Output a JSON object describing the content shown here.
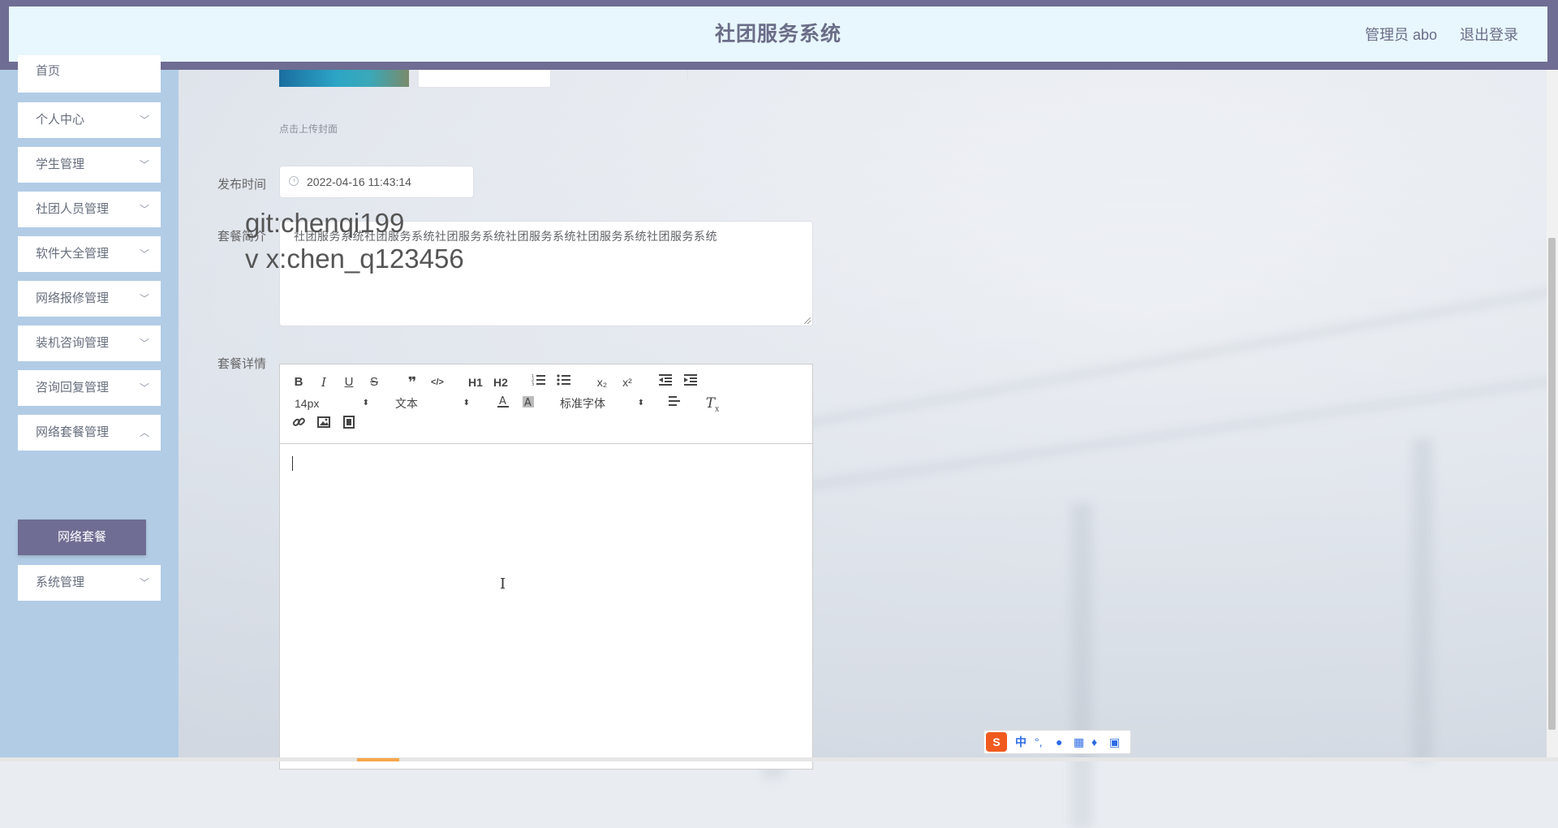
{
  "header": {
    "title": "社团服务系统",
    "user": "管理员 abo",
    "logout": "退出登录"
  },
  "sidebar": {
    "items": [
      {
        "label": "首页",
        "has_chevron": false
      },
      {
        "label": "个人中心",
        "has_chevron": true
      },
      {
        "label": "学生管理",
        "has_chevron": true
      },
      {
        "label": "社团人员管理",
        "has_chevron": true
      },
      {
        "label": "软件大全管理",
        "has_chevron": true
      },
      {
        "label": "网络报修管理",
        "has_chevron": true
      },
      {
        "label": "装机咨询管理",
        "has_chevron": true
      },
      {
        "label": "咨询回复管理",
        "has_chevron": true
      },
      {
        "label": "网络套餐管理",
        "has_chevron": true,
        "expanded": true
      },
      {
        "label": "系统管理",
        "has_chevron": true
      }
    ],
    "active_sub_item": "网络套餐",
    "active_color": "#6f6d93"
  },
  "form": {
    "cover_hint": "点击上传封面",
    "publish_time_label": "发布时间",
    "publish_time_value": "2022-04-16 11:43:14",
    "intro_label": "套餐简介",
    "intro_value": "社团服务系统社团服务系统社团服务系统社团服务系统社团服务系统社团服务系统",
    "detail_label": "套餐详情"
  },
  "watermark": {
    "line1": "git:chenqi199",
    "line2": "v x:chen_q123456"
  },
  "editor": {
    "font_size": "14px",
    "block_format": "文本",
    "font_family": "标准字体",
    "row1_tools": [
      "B",
      "I",
      "U",
      "S",
      "❞",
      "</>",
      "H1",
      "H2",
      "ordered-list",
      "bullet-list",
      "x₂",
      "x²",
      "outdent",
      "indent"
    ],
    "row2_tools": [
      "font-color",
      "background-color",
      "align",
      "clean"
    ],
    "row3_tools": [
      "link",
      "image",
      "video"
    ]
  },
  "ime": {
    "logo": "S",
    "mode": "中",
    "punct": "°,"
  },
  "colors": {
    "header_frame": "#6f6d93",
    "header_bg": "#e8f6fd",
    "sidebar_bg": "#b2cce6"
  }
}
